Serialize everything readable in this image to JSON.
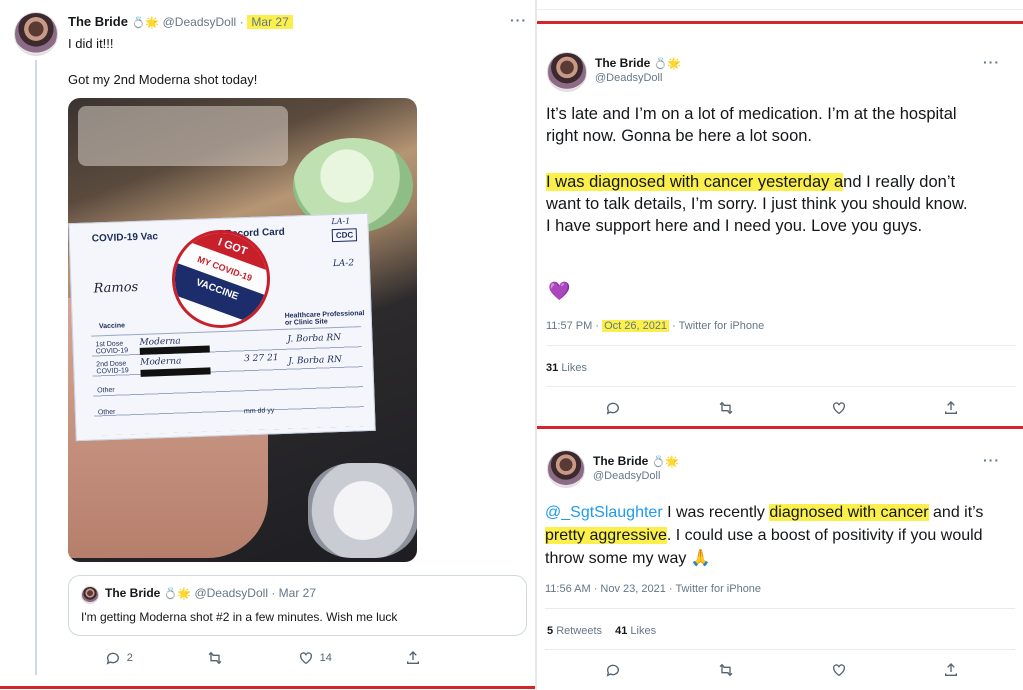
{
  "left": {
    "author_name": "The Bride",
    "handle": "@DeadsyDoll",
    "date": "Mar 27",
    "line1": "I did it!!!",
    "line2": "Got my 2nd Moderna shot today!",
    "photo": {
      "card_title": "COVID-19 Vac",
      "card_title2": "Record Card",
      "cdc": "CDC",
      "la_code": "LA-1",
      "la_code2": "LA-2",
      "sticker_top": "I GOT",
      "sticker_mid": "MY COVID-19",
      "sticker_bottom": "VACCINE",
      "col_vaccine": "Vaccine",
      "col_hcp": "Healthcare Professional or Clinic Site",
      "row1_label": "1st Dose COVID-19",
      "row1_val": "Moderna",
      "row1_sig": "J. Borba RN",
      "row2_label": "2nd Dose COVID-19",
      "row2_val": "Moderna",
      "row2_date": "3 27 21",
      "row2_sig": "J. Borba RN",
      "row3_label": "Other",
      "row4_label": "Other",
      "mm_dd_yy": "mm dd yy",
      "handwritten_name": "Ramos"
    },
    "quote": {
      "author_name": "The Bride",
      "handle": "@DeadsyDoll",
      "date": "Mar 27",
      "text": "I'm getting Moderna shot #2 in a few minutes. Wish me luck"
    },
    "actions": {
      "replies": "2",
      "likes": "14"
    }
  },
  "right_top": {
    "author_name": "The Bride",
    "handle": "@DeadsyDoll",
    "para1": "It’s late and I’m on a lot of medication. I’m at the hospital right now. Gonna be here a lot soon.",
    "para2_highlight": "I was diagnosed with cancer yesterday a",
    "para2_rest": "nd I really don’t want to talk details, I’m sorry. I just think you should know. I have support here and I need you. Love you guys.",
    "heart_emoji": "💜",
    "time": "11:57 PM ·",
    "date_highlight": "Oct 26, 2021",
    "source": "· Twitter for iPhone",
    "likes_count": "31",
    "likes_label": "Likes"
  },
  "right_bottom": {
    "author_name": "The Bride",
    "handle": "@DeadsyDoll",
    "mention": "@_SgtSlaughter",
    "text_a": " I was recently ",
    "text_hl1": "diagnosed with cancer",
    "text_b": " and it’s ",
    "text_hl2": "pretty aggressive",
    "text_c": ". I could use a boost of positivity if you would throw some my way ",
    "pray_emoji": "🙏",
    "time": "11:56 AM · Nov 23, 2021 · Twitter for iPhone",
    "retweets_count": "5",
    "retweets_label": "Retweets",
    "likes_count": "41",
    "likes_label": "Likes"
  },
  "colors": {
    "rule": "#d6242b",
    "highlight": "#fbef4c",
    "link": "#1d9bf0"
  },
  "icons": [
    "reply-icon",
    "retweet-icon",
    "like-icon",
    "share-icon",
    "more-icon",
    "ring-badge-icon",
    "emoji-badge-icon"
  ]
}
